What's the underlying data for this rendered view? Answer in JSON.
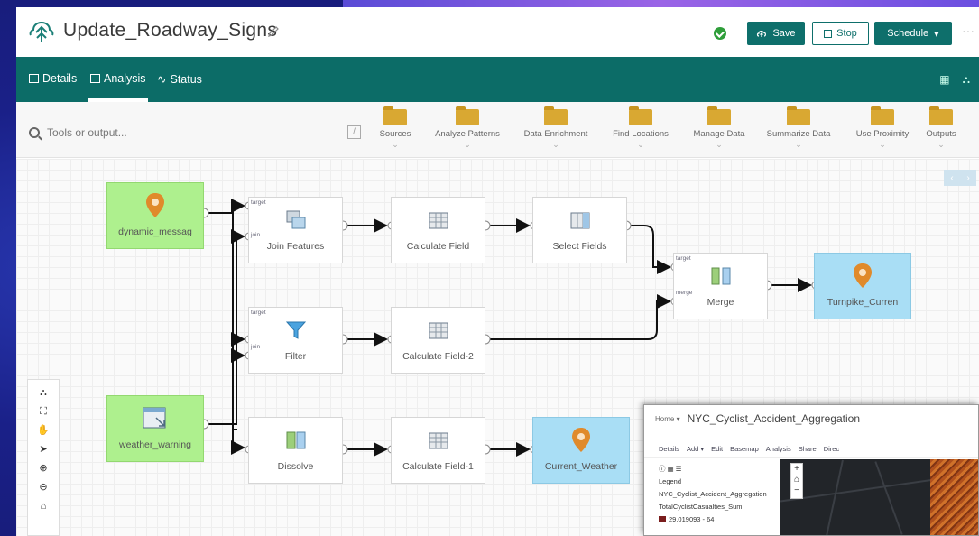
{
  "app": {
    "title": "Update_Roadway_Signs"
  },
  "header": {
    "save_label": "Save",
    "stop_label": "Stop",
    "schedule_label": "Schedule",
    "more_label": "···"
  },
  "nav": {
    "tabs": [
      {
        "label": "Details"
      },
      {
        "label": "Analysis"
      },
      {
        "label": "Status"
      }
    ],
    "active_tab": "Analysis"
  },
  "toolbar": {
    "search_placeholder": "Tools or output...",
    "shortcut_key": "/",
    "categories": [
      {
        "label": "Sources"
      },
      {
        "label": "Analyze Patterns"
      },
      {
        "label": "Data Enrichment"
      },
      {
        "label": "Find Locations"
      },
      {
        "label": "Manage Data"
      },
      {
        "label": "Summarize Data"
      },
      {
        "label": "Use Proximity"
      },
      {
        "label": "Outputs"
      }
    ]
  },
  "canvas": {
    "pager_prev": "‹",
    "pager_next": "›",
    "nodes": {
      "src1": "dynamic_messag",
      "src2": "weather_warning",
      "join": "Join Features",
      "calc": "Calculate Field",
      "select": "Select Fields",
      "merge": "Merge",
      "out1": "Turnpike_Curren",
      "filter": "Filter",
      "calc2": "Calculate Field-2",
      "dissolve": "Dissolve",
      "calc1": "Calculate Field-1",
      "out2": "Current_Weather"
    },
    "port_labels": {
      "target": "target",
      "join": "join",
      "merge": "merge"
    }
  },
  "colors": {
    "accent": "#0e6f6b",
    "source_node": "#aef08e",
    "output_node": "#a9def5",
    "status_ok": "#2f9e3a"
  },
  "inset": {
    "home": "Home ▾",
    "title": "NYC_Cyclist_Accident_Aggregation",
    "bar_items": [
      "Details",
      "Add ▾",
      "Edit",
      "Basemap",
      "Analysis",
      "Share",
      "Direc"
    ],
    "legend_heading": "Legend",
    "layer_name": "NYC_Cyclist_Accident_Aggregation",
    "field_name": "TotalCyclistCasualties_Sum",
    "class_range": "29.019093 - 64"
  }
}
